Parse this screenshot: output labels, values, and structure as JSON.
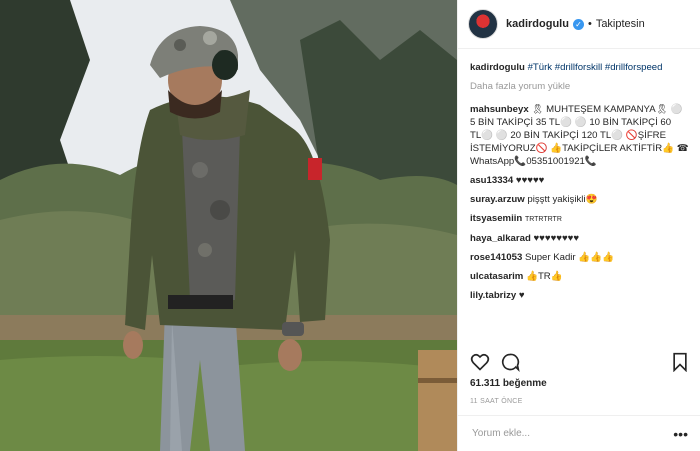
{
  "header": {
    "username": "kadirdogulu",
    "follow_status": "Takiptesin",
    "separator": "•"
  },
  "caption": {
    "username": "kadirdogulu",
    "hashtags": "#Türk #drillforskill #drillforspeed"
  },
  "load_more": "Daha fazla yorum yükle",
  "comments": [
    {
      "user": "mahsunbeyx",
      "text": "🎗 MUHTEŞEM KAMPANYA🎗 ⚪ 5 BİN TAKİPÇİ 35 TL⚪ ⚪ 10 BİN TAKİPÇİ 60 TL⚪ ⚪ 20 BİN TAKİPÇİ 120 TL⚪ 🚫ŞİFRE İSTEMİYORUZ🚫 👍TAKİPÇİLER AKTİFTİR👍 ☎ WhatsApp📞05351001921📞"
    },
    {
      "user": "asu13334",
      "text": "♥♥♥♥♥"
    },
    {
      "user": "suray.arzuw",
      "text": "pişştt yakişikli😍"
    },
    {
      "user": "itsyasemiin",
      "text": "TRTRTRTR"
    },
    {
      "user": "haya_alkarad",
      "text": "♥♥♥♥♥♥♥♥"
    },
    {
      "user": "rose141053",
      "text": "Super Kadir 👍👍👍"
    },
    {
      "user": "ulcatasarim",
      "text": "👍TR👍"
    },
    {
      "user": "lily.tabrizy",
      "text": "♥"
    }
  ],
  "likes": "61.311 beğenme",
  "timestamp": "11 SAAT ÖNCE",
  "add_comment_placeholder": "Yorum ekle...",
  "more_options": "•••",
  "icons": {
    "like": "heart-icon",
    "comment": "speech-bubble-icon",
    "save": "bookmark-icon",
    "verified": "verified-badge-icon"
  },
  "colors": {
    "verified": "#3897f0",
    "hashtag": "#003569",
    "muted": "#999999",
    "text": "#262626"
  }
}
